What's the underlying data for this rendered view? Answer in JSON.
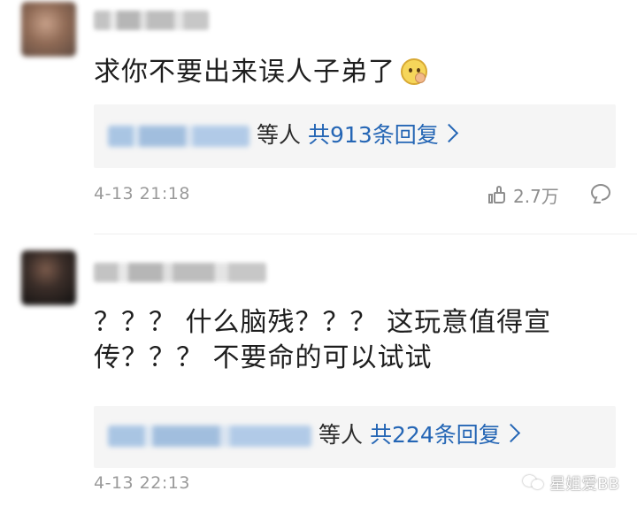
{
  "comments": [
    {
      "text": "求你不要出来误人子弟了",
      "emoji": "smirk-emoji",
      "replies": {
        "others": "等人",
        "count": "共913条回复"
      },
      "time": "4-13 21:18",
      "likes": "2.7万"
    },
    {
      "text": "？？？ 什么脑残？？？ 这玩意值得宣传？？？ 不要命的可以试试",
      "replies": {
        "others": "等人",
        "count": "共224条回复"
      },
      "time": "4-13 22:13"
    }
  ],
  "watermark": {
    "text": "星姐爱BB"
  },
  "colors": {
    "link": "#2566b5",
    "meta": "#9a9a9a",
    "reply_bg": "#f5f5f5"
  }
}
